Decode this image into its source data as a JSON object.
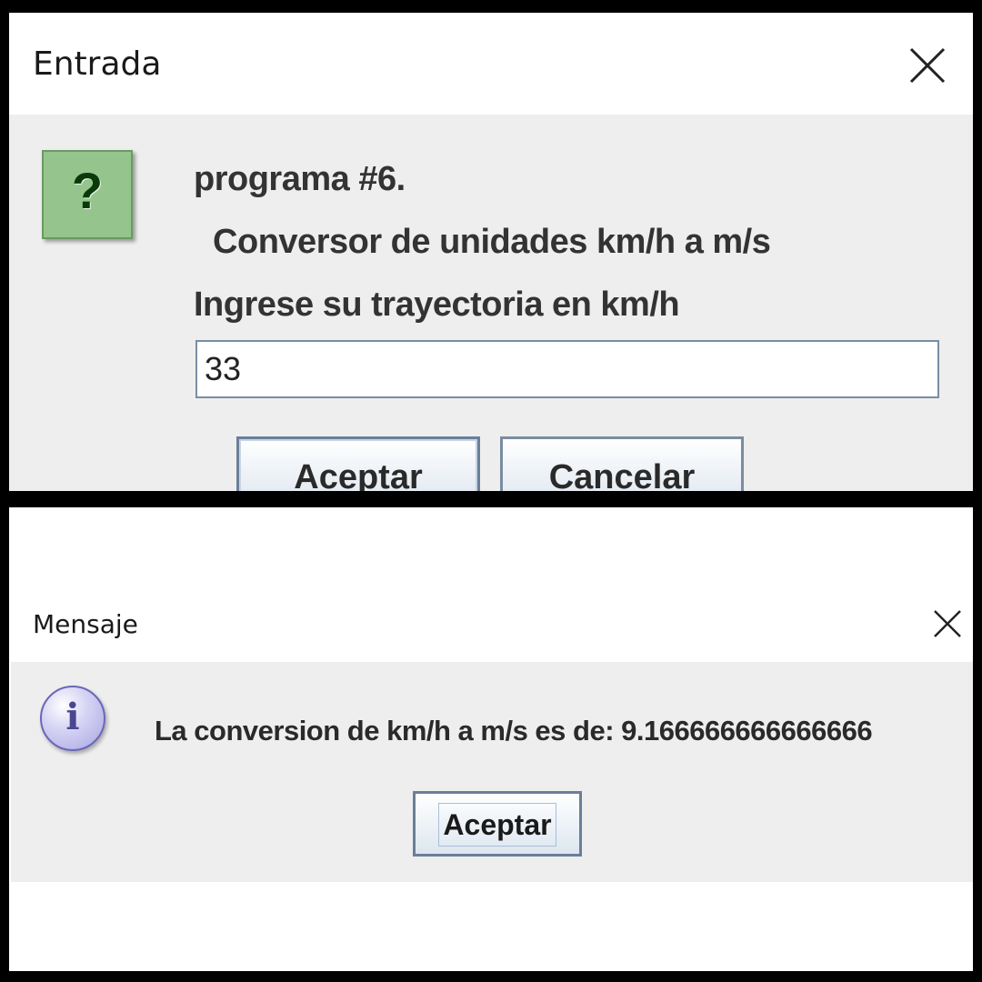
{
  "input_dialog": {
    "title": "Entrada",
    "close_icon": "close-icon",
    "icon": "question-icon",
    "icon_glyph": "?",
    "icon_color": "#95c58c",
    "lines": [
      "programa #6.",
      " Conversor de unidades km/h a m/s",
      "Ingrese su trayectoria en km/h"
    ],
    "input_value": "33",
    "ok_label": "Aceptar",
    "cancel_label": "Cancelar"
  },
  "message_dialog": {
    "title": "Mensaje",
    "close_icon": "close-icon",
    "icon": "info-icon",
    "icon_glyph": "i",
    "message": "La conversion de km/h a m/s es de: 9.166666666666666",
    "ok_label": "Aceptar"
  }
}
